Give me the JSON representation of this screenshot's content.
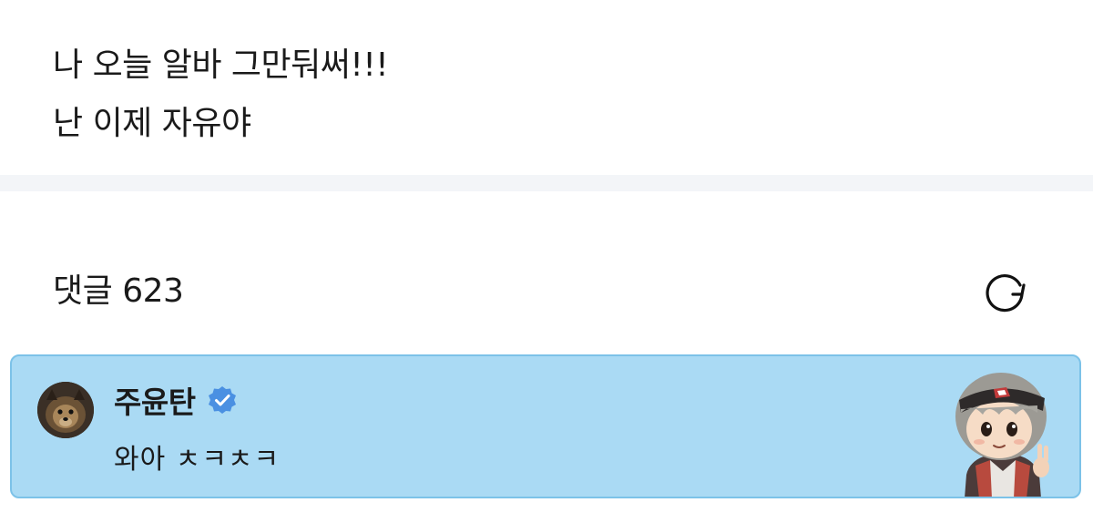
{
  "post": {
    "lines": [
      "나 오늘 알바 그만둬써!!!",
      "난 이제 자유야"
    ]
  },
  "comments_section": {
    "title_label": "댓글",
    "count": "623",
    "refresh_icon": "refresh-icon"
  },
  "comment": {
    "author": "주윤탄",
    "verified": true,
    "verified_icon": "verified-badge-icon",
    "text": "와아 ㅊㅋㅊㅋ",
    "avatar_icon": "dog-avatar",
    "sticker_icon": "character-sticker"
  },
  "colors": {
    "highlight_bg": "#aadaf4",
    "highlight_border": "#7cc2e8",
    "verified_blue": "#4a90e2",
    "divider": "#f3f5f8"
  }
}
